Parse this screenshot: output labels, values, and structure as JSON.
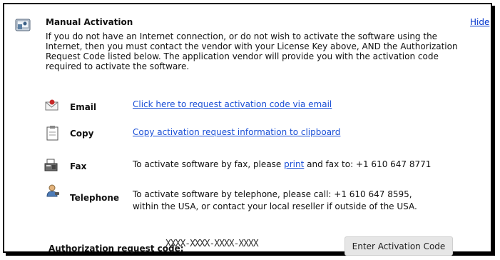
{
  "header": {
    "title": "Manual Activation",
    "hide_label": "Hide",
    "icon": "computer-key-icon"
  },
  "description": "If you do not have an Internet connection, or do not wish to activate the software using the Internet, then you must contact the vendor with your License Key above, AND the Authorization Request Code listed below. The application vendor will provide you with the activation code required to activate the software.",
  "methods": {
    "email": {
      "icon": "email-icon",
      "label": "Email",
      "link": "Click here to request activation code via email"
    },
    "copy": {
      "icon": "clipboard-icon",
      "label": "Copy",
      "link": "Copy activation request information to clipboard"
    },
    "fax": {
      "icon": "fax-icon",
      "label": "Fax",
      "text_before": "To activate software by fax, please ",
      "link": "print",
      "text_after": " and fax to: +1 610 647 8771"
    },
    "telephone": {
      "icon": "telephone-user-icon",
      "label": "Telephone",
      "line1": "To activate software by telephone, please call: +1 610 647 8595,",
      "line2": "within the USA, or contact your local reseller if outside of the USA."
    }
  },
  "authorization": {
    "label": "Authorization request code:",
    "code": "XXXX-XXXX-XXXX-XXXX",
    "button_label": "Enter Activation Code"
  },
  "colors": {
    "link": "#1a4fd6",
    "border": "#000000",
    "button_bg": "#e6e6e6"
  }
}
